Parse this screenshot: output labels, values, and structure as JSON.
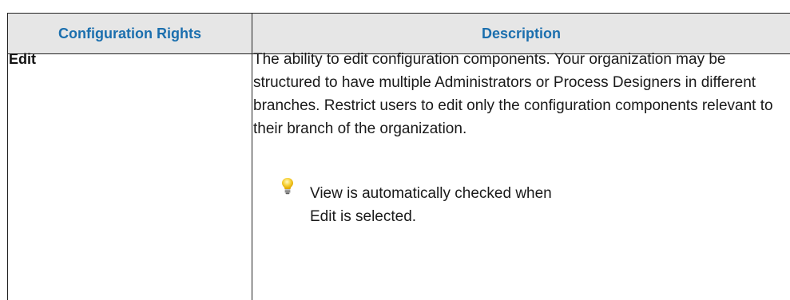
{
  "table": {
    "headers": [
      "Configuration Rights",
      "Description"
    ],
    "rows": [
      {
        "right": "Edit",
        "description": "The ability to edit configuration components. Your organization may be structured to have multiple Administrators or Process Designers in different branches. Restrict users to edit only the configuration components relevant to their branch of the organization.",
        "tip": {
          "icon": "lightbulb-icon",
          "text": "View is automatically checked when Edit is selected."
        }
      }
    ]
  },
  "colors": {
    "header_text": "#1b6fae",
    "header_background": "#e6e6e6",
    "border": "#222222"
  }
}
